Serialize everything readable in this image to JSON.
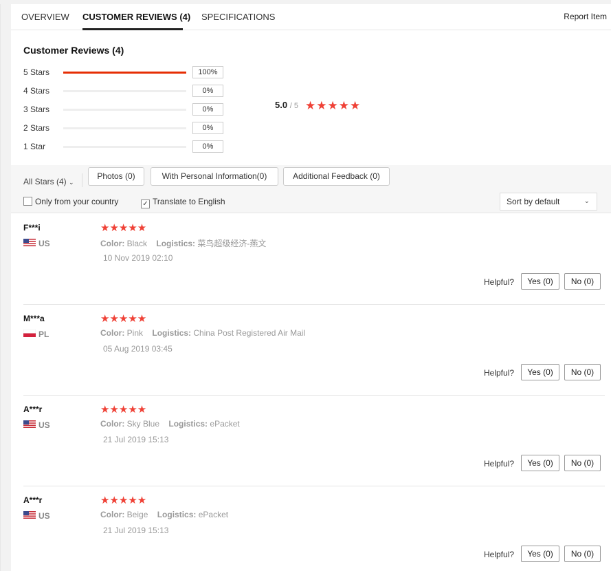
{
  "tabs": {
    "overview": "OVERVIEW",
    "reviews": "CUSTOMER REVIEWS (4)",
    "specifications": "SPECIFICATIONS",
    "report": "Report Item"
  },
  "summary": {
    "title": "Customer Reviews (4)",
    "rows": [
      {
        "label": "5 Stars",
        "percent": "100%",
        "fraction": 1.0
      },
      {
        "label": "4 Stars",
        "percent": "0%",
        "fraction": 0
      },
      {
        "label": "3 Stars",
        "percent": "0%",
        "fraction": 0
      },
      {
        "label": "2 Stars",
        "percent": "0%",
        "fraction": 0
      },
      {
        "label": "1 Star",
        "percent": "0%",
        "fraction": 0
      }
    ],
    "average": "5.0",
    "out_of": "/ 5",
    "average_stars": "★★★★★",
    "star_color": "#ef4136"
  },
  "filters": {
    "all_stars": "All Stars (4)",
    "photos": "Photos (0)",
    "personal_info": "With Personal Information(0)",
    "additional_feedback": "Additional Feedback (0)",
    "only_country": "Only from your country",
    "only_country_checked": false,
    "translate": "Translate to English",
    "translate_checked": true,
    "sort": "Sort by default"
  },
  "reviews": [
    {
      "name": "F***i",
      "country": "US",
      "stars": "★★★★★",
      "color_key": "Color:",
      "color": "Black",
      "logistics_key": "Logistics:",
      "logistics": "菜鸟超级经济-燕文",
      "date": "10 Nov 2019 02:10",
      "helpful": "Helpful?",
      "yes": "Yes (0)",
      "no": "No (0)"
    },
    {
      "name": "M***a",
      "country": "PL",
      "stars": "★★★★★",
      "color_key": "Color:",
      "color": "Pink",
      "logistics_key": "Logistics:",
      "logistics": "China Post Registered Air Mail",
      "date": "05 Aug 2019 03:45",
      "helpful": "Helpful?",
      "yes": "Yes (0)",
      "no": "No (0)"
    },
    {
      "name": "A***r",
      "country": "US",
      "stars": "★★★★★",
      "color_key": "Color:",
      "color": "Sky Blue",
      "logistics_key": "Logistics:",
      "logistics": "ePacket",
      "date": "21 Jul 2019 15:13",
      "helpful": "Helpful?",
      "yes": "Yes (0)",
      "no": "No (0)"
    },
    {
      "name": "A***r",
      "country": "US",
      "stars": "★★★★★",
      "color_key": "Color:",
      "color": "Beige",
      "logistics_key": "Logistics:",
      "logistics": "ePacket",
      "date": "21 Jul 2019 15:13",
      "helpful": "Helpful?",
      "yes": "Yes (0)",
      "no": "No (0)"
    }
  ]
}
